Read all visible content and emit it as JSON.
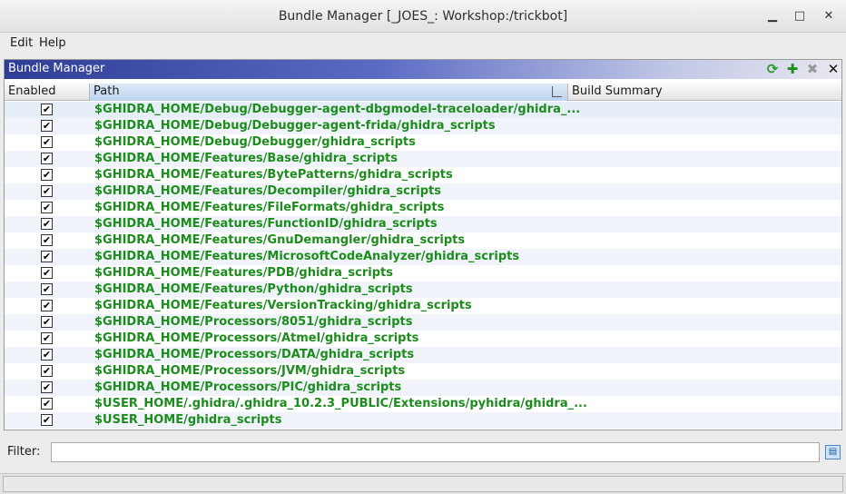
{
  "window": {
    "title": "Bundle Manager [_JOES_: Workshop:/trickbot]",
    "min_glyph": "▁",
    "max_glyph": "□",
    "close_glyph": "✕"
  },
  "menu": [
    {
      "label": "Edit"
    },
    {
      "label": "Help"
    }
  ],
  "panel": {
    "title": "Bundle Manager",
    "tools": {
      "refresh_icon": "refresh-icon",
      "add_icon": "add-icon",
      "remove_icon": "remove-icon",
      "close_icon": "close-icon",
      "refresh_glyph": "⟳",
      "add_glyph": "✚",
      "remove_glyph": "✖",
      "close_glyph": "✕"
    },
    "colors": {
      "path_text": "#1c8c1c",
      "header_gradient_start": "#2e3d96"
    }
  },
  "table": {
    "columns": [
      "Enabled",
      "Path",
      "Build Summary"
    ],
    "sorted_column": "Path",
    "rows": [
      {
        "enabled": true,
        "path": "$GHIDRA_HOME/Debug/Debugger-agent-dbgmodel-traceloader/ghidra_..."
      },
      {
        "enabled": true,
        "path": "$GHIDRA_HOME/Debug/Debugger-agent-frida/ghidra_scripts"
      },
      {
        "enabled": true,
        "path": "$GHIDRA_HOME/Debug/Debugger/ghidra_scripts"
      },
      {
        "enabled": true,
        "path": "$GHIDRA_HOME/Features/Base/ghidra_scripts"
      },
      {
        "enabled": true,
        "path": "$GHIDRA_HOME/Features/BytePatterns/ghidra_scripts"
      },
      {
        "enabled": true,
        "path": "$GHIDRA_HOME/Features/Decompiler/ghidra_scripts"
      },
      {
        "enabled": true,
        "path": "$GHIDRA_HOME/Features/FileFormats/ghidra_scripts"
      },
      {
        "enabled": true,
        "path": "$GHIDRA_HOME/Features/FunctionID/ghidra_scripts"
      },
      {
        "enabled": true,
        "path": "$GHIDRA_HOME/Features/GnuDemangler/ghidra_scripts"
      },
      {
        "enabled": true,
        "path": "$GHIDRA_HOME/Features/MicrosoftCodeAnalyzer/ghidra_scripts"
      },
      {
        "enabled": true,
        "path": "$GHIDRA_HOME/Features/PDB/ghidra_scripts"
      },
      {
        "enabled": true,
        "path": "$GHIDRA_HOME/Features/Python/ghidra_scripts"
      },
      {
        "enabled": true,
        "path": "$GHIDRA_HOME/Features/VersionTracking/ghidra_scripts"
      },
      {
        "enabled": true,
        "path": "$GHIDRA_HOME/Processors/8051/ghidra_scripts"
      },
      {
        "enabled": true,
        "path": "$GHIDRA_HOME/Processors/Atmel/ghidra_scripts"
      },
      {
        "enabled": true,
        "path": "$GHIDRA_HOME/Processors/DATA/ghidra_scripts"
      },
      {
        "enabled": true,
        "path": "$GHIDRA_HOME/Processors/JVM/ghidra_scripts"
      },
      {
        "enabled": true,
        "path": "$GHIDRA_HOME/Processors/PIC/ghidra_scripts"
      },
      {
        "enabled": true,
        "path": "$USER_HOME/.ghidra/.ghidra_10.2.3_PUBLIC/Extensions/pyhidra/ghidra_..."
      },
      {
        "enabled": true,
        "path": "$USER_HOME/ghidra_scripts"
      }
    ]
  },
  "filter": {
    "label": "Filter:",
    "value": "",
    "placeholder": "",
    "icon": "filter-options-icon"
  },
  "status": {
    "text": ""
  }
}
